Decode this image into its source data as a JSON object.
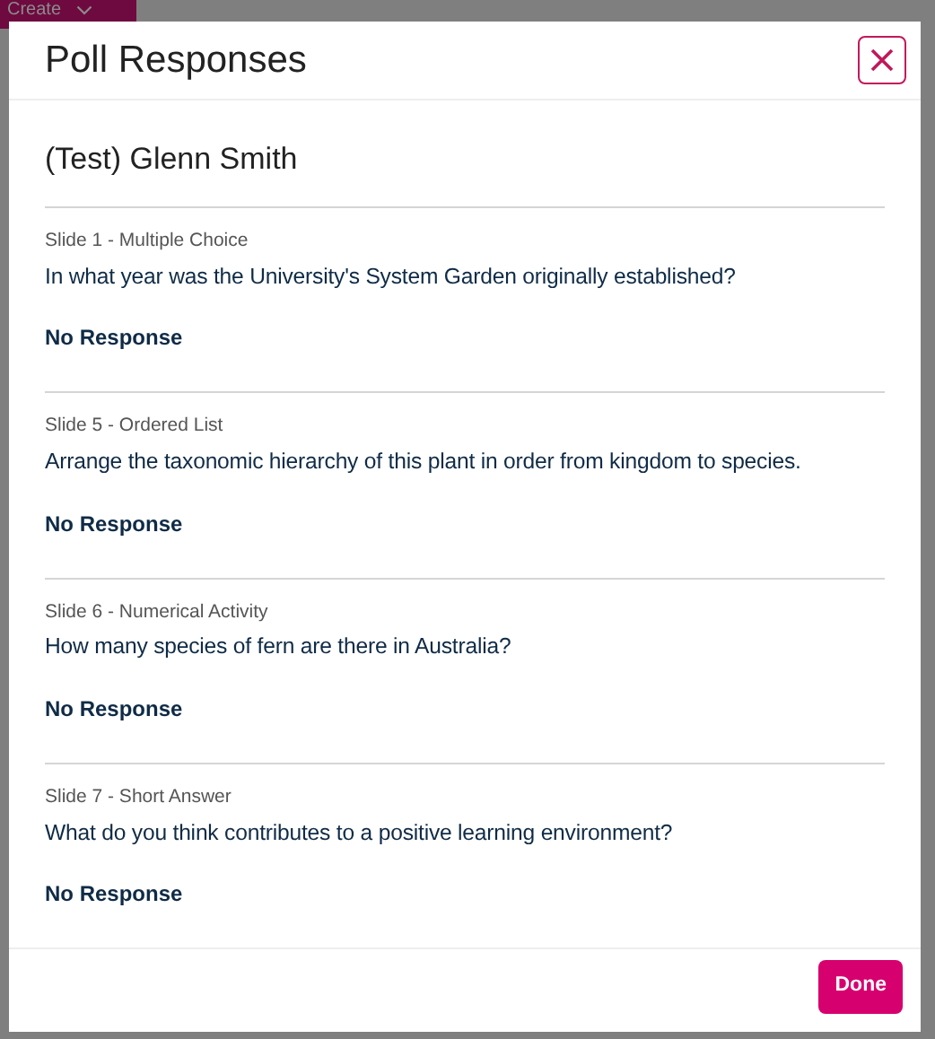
{
  "background": {
    "create_button": "Create"
  },
  "dialog": {
    "title": "Poll Responses",
    "participant": "(Test) Glenn Smith",
    "responses": [
      {
        "slide": "Slide 1 - Multiple Choice",
        "question": "In what year was the University's System Garden originally established?",
        "answer": "No Response"
      },
      {
        "slide": "Slide 5 - Ordered List",
        "question": "Arrange the taxonomic hierarchy of this plant in order from kingdom to species.",
        "answer": "No Response"
      },
      {
        "slide": "Slide 6 - Numerical Activity",
        "question": "How many species of fern are there in Australia?",
        "answer": "No Response"
      },
      {
        "slide": "Slide 7 - Short Answer",
        "question": "What do you think contributes to a positive learning environment?",
        "answer": "No Response"
      }
    ],
    "done_button": "Done"
  }
}
